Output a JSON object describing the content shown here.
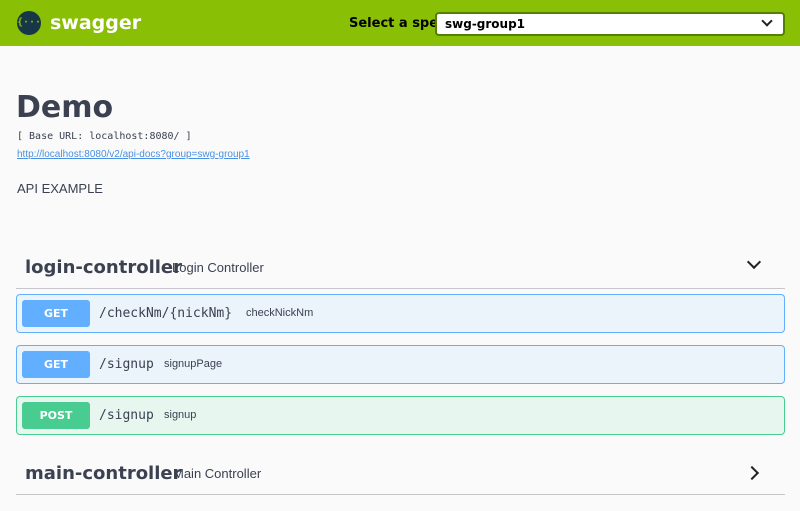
{
  "topbar": {
    "logo_glyph": "{···}",
    "brand": "swagger",
    "spec_label": "Select a spec",
    "spec_selected": "swg-group1",
    "color": "#89bf04"
  },
  "info": {
    "title": "Demo",
    "base_url": "[ Base URL: localhost:8080/ ]",
    "api_docs_link": "http://localhost:8080/v2/api-docs?group=swg-group1",
    "description": "API EXAMPLE"
  },
  "tags": [
    {
      "name": "login-controller",
      "description": "Login Controller",
      "expanded": true,
      "operations": [
        {
          "method": "GET",
          "path": "/checkNm/{nickNm}",
          "summary": "checkNickNm"
        },
        {
          "method": "GET",
          "path": "/signup",
          "summary": "signupPage"
        },
        {
          "method": "POST",
          "path": "/signup",
          "summary": "signup"
        }
      ]
    },
    {
      "name": "main-controller",
      "description": "Main Controller",
      "expanded": false
    }
  ],
  "colors": {
    "get": "#61affe",
    "post": "#49cc90"
  }
}
